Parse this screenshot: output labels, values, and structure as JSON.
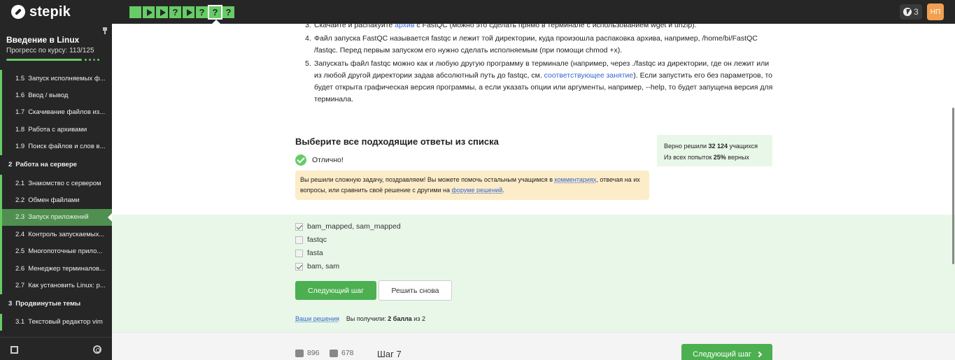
{
  "app": {
    "logo": "stepik"
  },
  "topbar": {
    "steps": [
      {
        "type": "check"
      },
      {
        "type": "play"
      },
      {
        "type": "play"
      },
      {
        "type": "quiz",
        "label": "?"
      },
      {
        "type": "play"
      },
      {
        "type": "quiz",
        "label": "?"
      },
      {
        "type": "quiz",
        "label": "?",
        "active": true
      },
      {
        "type": "quiz",
        "label": "?"
      }
    ],
    "energy_count": "3",
    "avatar_initials": "НП"
  },
  "sidebar": {
    "course_title": "Введение в Linux",
    "progress_text": "Прогресс по курсу:  113/125",
    "progress_fraction": 0.904,
    "lessons": [
      {
        "num": "1.5",
        "label": "Запуск исполняемых ф..."
      },
      {
        "num": "1.6",
        "label": "Ввод / вывод"
      },
      {
        "num": "1.7",
        "label": "Скачивание файлов из..."
      },
      {
        "num": "1.8",
        "label": "Работа с архивами"
      },
      {
        "num": "1.9",
        "label": "Поиск файлов и слов в..."
      }
    ],
    "section2": {
      "num": "2",
      "label": "Работа на сервере"
    },
    "lessons2": [
      {
        "num": "2.1",
        "label": "Знакомство с сервером"
      },
      {
        "num": "2.2",
        "label": "Обмен файлами"
      },
      {
        "num": "2.3",
        "label": "Запуск приложений"
      },
      {
        "num": "2.4",
        "label": "Контроль запускаемых..."
      },
      {
        "num": "2.5",
        "label": "Многопоточные прило..."
      },
      {
        "num": "2.6",
        "label": "Менеджер терминалов..."
      },
      {
        "num": "2.7",
        "label": "Как установить Linux: р..."
      }
    ],
    "section3": {
      "num": "3",
      "label": "Продвинутые темы"
    },
    "lessons3": [
      {
        "num": "3.1",
        "label": "Текстовый редактор vim"
      }
    ]
  },
  "instructions": {
    "item3": {
      "num": "3.",
      "before": "Скачайте и распакуйте ",
      "link": "архив",
      "after": " с FastQC (можно это сделать прямо в терминале с использованием wget и unzip)."
    },
    "item4": {
      "num": "4.",
      "text": "Файл запуска FastQC называется fastqc и лежит той директории, куда произошла распаковка архива, например, /home/bi/FastQC /fastqc. Перед первым запуском его нужно сделать исполняемым (при помощи chmod +x)."
    },
    "item5": {
      "num": "5.",
      "before": "Запускать файл fastqc можно как и любую другую программу в терминале (например, через ./fastqc из директории, где он лежит или из любой другой директории задав абсолютный путь до fastqc, см. ",
      "link": "соответствующее занятие",
      "after": "). Если запустить его без параметров, то будет открыта графическая версия программы, а если указать опции или аргументы, например, --help, то будет запущена версия для терминала."
    }
  },
  "task": {
    "title": "Выберите все подходящие ответы из списка",
    "success": "Отлично!",
    "notice": {
      "part1": "Вы решили сложную задачу, поздравляем! Вы можете помочь остальным учащимся в ",
      "link1": "комментариях",
      "part2": ", отвечая на их вопросы, или сравнить своё решение с другими на ",
      "link2": "форуме решений",
      "part3": "."
    },
    "stats": {
      "line1_prefix": "Верно решили ",
      "line1_value": "32 124",
      "line1_suffix": " учащихся",
      "line2_prefix": "Из всех попыток ",
      "line2_value": "25%",
      "line2_suffix": " верных"
    },
    "options": [
      {
        "label": "bam_mapped, sam_mapped",
        "checked": true
      },
      {
        "label": "fastqc",
        "checked": false
      },
      {
        "label": "fasta",
        "checked": false
      },
      {
        "label": "bam, sam",
        "checked": true
      }
    ],
    "next_button": "Следующий шаг",
    "retry_button": "Решить снова",
    "solutions_link": "Ваши решения",
    "score_prefix": "Вы получили: ",
    "score_value": "2 балла",
    "score_suffix": " из 2"
  },
  "footer": {
    "likes": "896",
    "dislikes": "678",
    "step_label": "Шаг 7",
    "next_button": "Следующий шаг"
  },
  "colors": {
    "accent": "#66cc66",
    "button": "#4caf50",
    "dark": "#262626",
    "notice_bg": "#fdecc8",
    "answer_bg": "#e9f7e9"
  }
}
